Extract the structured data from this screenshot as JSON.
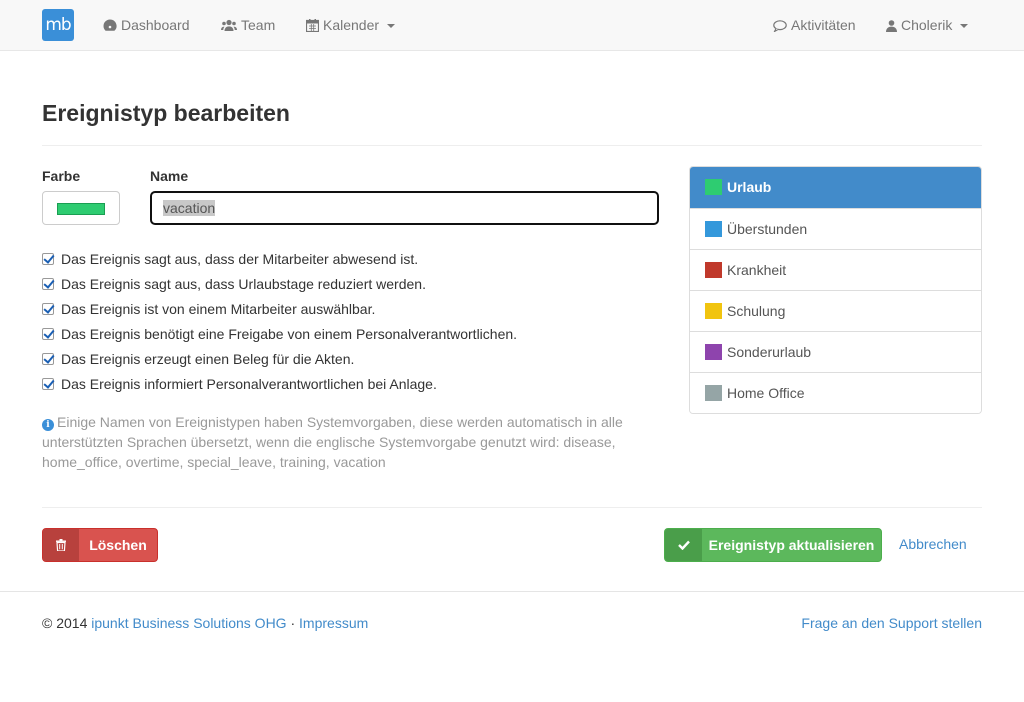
{
  "brand": {
    "logo_text": "mb"
  },
  "nav": {
    "dashboard": "Dashboard",
    "team": "Team",
    "calendar": "Kalender",
    "activities": "Aktivitäten",
    "user": "Cholerik"
  },
  "page": {
    "title": "Ereignistyp bearbeiten"
  },
  "form": {
    "color_label": "Farbe",
    "name_label": "Name",
    "color_value": "#2ecc71",
    "name_value": "vacation",
    "checkboxes": [
      {
        "label": "Das Ereignis sagt aus, dass der Mitarbeiter abwesend ist.",
        "checked": true
      },
      {
        "label": "Das Ereignis sagt aus, dass Urlaubstage reduziert werden.",
        "checked": true
      },
      {
        "label": "Das Ereignis ist von einem Mitarbeiter auswählbar.",
        "checked": true
      },
      {
        "label": "Das Ereignis benötigt eine Freigabe von einem Personalverantwortlichen.",
        "checked": true
      },
      {
        "label": "Das Ereignis erzeugt einen Beleg für die Akten.",
        "checked": true
      },
      {
        "label": "Das Ereignis informiert Personalverantwortlichen bei Anlage.",
        "checked": true
      }
    ],
    "help_text": "Einige Namen von Ereignistypen haben Systemvorgaben, diese werden automatisch in alle unterstützten Sprachen übersetzt, wenn die englische Systemvorgabe genutzt wird: disease, home_office, overtime, special_leave, training, vacation"
  },
  "event_types": [
    {
      "label": "Urlaub",
      "color": "#2ecc71",
      "active": true
    },
    {
      "label": "Überstunden",
      "color": "#3498db",
      "active": false
    },
    {
      "label": "Krankheit",
      "color": "#c0392b",
      "active": false
    },
    {
      "label": "Schulung",
      "color": "#f1c40f",
      "active": false
    },
    {
      "label": "Sonderurlaub",
      "color": "#8e44ad",
      "active": false
    },
    {
      "label": "Home Office",
      "color": "#95a5a6",
      "active": false
    }
  ],
  "actions": {
    "delete": "Löschen",
    "update": "Ereignistyp aktualisieren",
    "cancel": "Abbrechen"
  },
  "footer": {
    "copyright": "© 2014",
    "company": "ipunkt Business Solutions OHG",
    "separator": "·",
    "imprint": "Impressum",
    "support": "Frage an den Support stellen"
  },
  "colors": {
    "primary": "#428bca",
    "success": "#5cb85c",
    "danger": "#d9534f"
  }
}
